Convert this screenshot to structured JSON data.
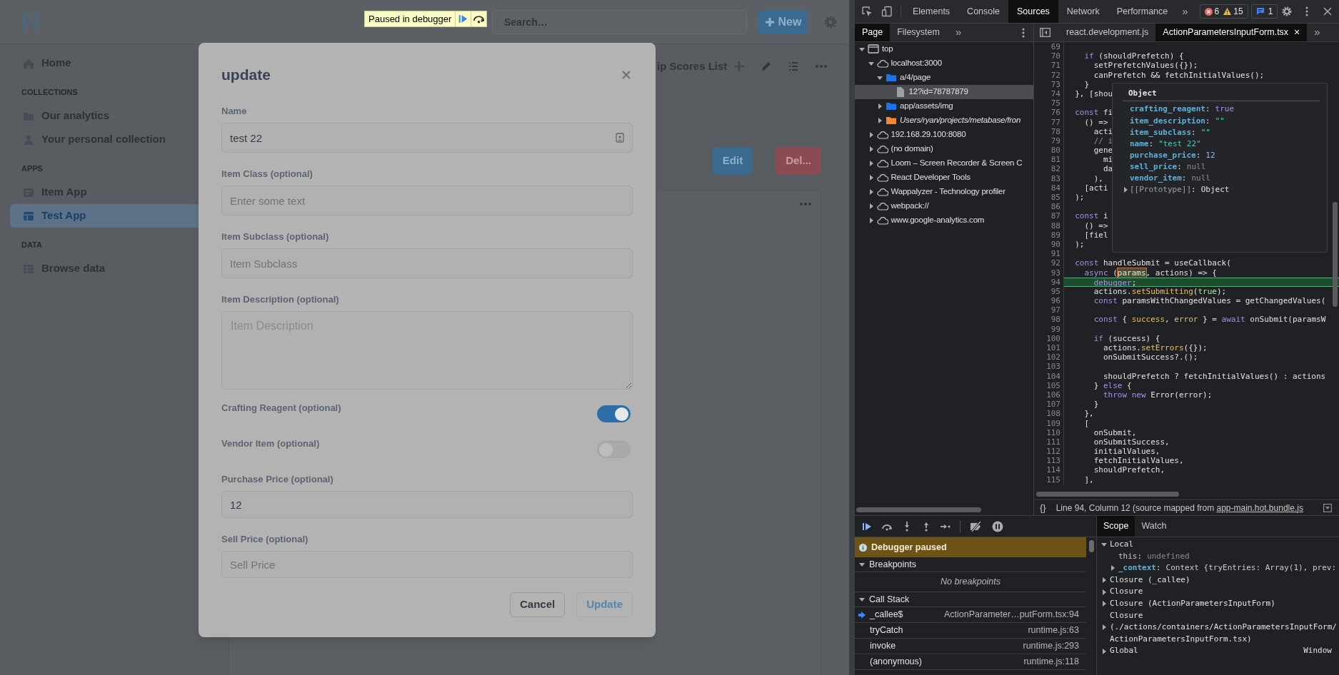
{
  "app": {
    "debugger_banner": {
      "label": "Paused in debugger"
    },
    "search": {
      "placeholder": "Search…"
    },
    "new_button": "New",
    "sidebar": [
      {
        "kind": "link",
        "label": "Home",
        "selected": false
      },
      {
        "kind": "heading",
        "label": "COLLECTIONS"
      },
      {
        "kind": "link",
        "label": "Our analytics",
        "selected": false
      },
      {
        "kind": "link",
        "label": "Your personal collection",
        "selected": false
      },
      {
        "kind": "heading",
        "label": "APPS"
      },
      {
        "kind": "link",
        "label": "Item App",
        "selected": false
      },
      {
        "kind": "link",
        "label": "Test App",
        "selected": true
      },
      {
        "kind": "heading",
        "label": "DATA"
      },
      {
        "kind": "link",
        "label": "Browse data",
        "selected": false
      }
    ],
    "page": {
      "title": "ip Scores List",
      "buttons": [
        {
          "label": "Edit",
          "kind": "primary"
        },
        {
          "label": "Del...",
          "kind": "danger"
        }
      ]
    },
    "modal": {
      "title": "update",
      "fields": [
        {
          "kind": "text",
          "label": "Name",
          "value": "test 22"
        },
        {
          "kind": "text",
          "label": "Item Class (optional)",
          "placeholder": "Enter some text"
        },
        {
          "kind": "text",
          "label": "Item Subclass (optional)",
          "placeholder": "Item Subclass"
        },
        {
          "kind": "textarea",
          "label": "Item Description (optional)",
          "placeholder": "Item Description"
        },
        {
          "kind": "toggle",
          "label": "Crafting Reagent (optional)",
          "on": true
        },
        {
          "kind": "toggle",
          "label": "Vendor Item (optional)",
          "on": false
        },
        {
          "kind": "text",
          "label": "Purchase Price (optional)",
          "value": "12"
        },
        {
          "kind": "text",
          "label": "Sell Price (optional)",
          "placeholder": "Sell Price"
        }
      ],
      "buttons": [
        {
          "label": "Cancel",
          "disabled": false
        },
        {
          "label": "Update",
          "disabled": true
        }
      ]
    }
  },
  "devtools": {
    "tabs": [
      {
        "label": "Elements",
        "selected": false
      },
      {
        "label": "Console",
        "selected": false
      },
      {
        "label": "Sources",
        "selected": true
      },
      {
        "label": "Network",
        "selected": false
      },
      {
        "label": "Performance",
        "selected": false
      }
    ],
    "more_tabs": "»",
    "counts": {
      "errors": "6",
      "warnings": "15",
      "messages": "1"
    },
    "navigator": {
      "tabs": [
        {
          "label": "Page",
          "selected": true
        },
        {
          "label": "Filesystem",
          "selected": false
        }
      ],
      "more": "»",
      "tree": [
        {
          "kind": "frame",
          "label": "top",
          "expanded": true,
          "selected": false,
          "children": [
            {
              "kind": "domain",
              "label": "localhost:3000",
              "expanded": true,
              "selected": false,
              "children": [
                {
                  "kind": "folder",
                  "label": "a/4/page",
                  "expanded": true,
                  "selected": false,
                  "children": [
                    {
                      "kind": "file",
                      "label": "12?id=78787879",
                      "selected": true
                    }
                  ]
                },
                {
                  "kind": "folder",
                  "label": "app/assets/img",
                  "expanded": false,
                  "selected": false
                },
                {
                  "kind": "override-folder",
                  "label": "Users/ryan/projects/metabase/fron",
                  "expanded": false,
                  "selected": false
                }
              ]
            },
            {
              "kind": "domain",
              "label": "192.168.29.100:8080",
              "expanded": false,
              "selected": false
            },
            {
              "kind": "domain",
              "label": "(no domain)",
              "expanded": false,
              "selected": false
            },
            {
              "kind": "domain",
              "label": "Loom – Screen Recorder & Screen C",
              "expanded": false,
              "selected": false
            },
            {
              "kind": "domain",
              "label": "React Developer Tools",
              "expanded": false,
              "selected": false
            },
            {
              "kind": "domain",
              "label": "Wappalyzer - Technology profiler",
              "expanded": false,
              "selected": false
            },
            {
              "kind": "domain",
              "label": "webpack://",
              "expanded": false,
              "selected": false
            },
            {
              "kind": "domain",
              "label": "www.google-analytics.com",
              "expanded": false,
              "selected": false
            }
          ]
        }
      ]
    },
    "editor": {
      "tabs": [
        {
          "label": "react.development.js",
          "selected": false
        },
        {
          "label": "ActionParametersInputForm.tsx",
          "selected": true
        }
      ],
      "close": "×",
      "more": "»",
      "lines": [
        {
          "n": "69",
          "paused": false
        },
        {
          "n": "70",
          "paused": false,
          "code": [
            {
              "kind": "keyword",
              "text": "    if"
            },
            {
              "kind": "plain",
              "text": " (shouldPrefetch) {"
            }
          ]
        },
        {
          "n": "71",
          "paused": false,
          "code": [
            {
              "kind": "plain",
              "text": "      setPrefetchValues({});"
            }
          ]
        },
        {
          "n": "72",
          "paused": false,
          "code": [
            {
              "kind": "plain",
              "text": "      canPrefetch && fetchInitialValues();"
            }
          ]
        },
        {
          "n": "73",
          "paused": false,
          "code": [
            {
              "kind": "plain",
              "text": "    }"
            }
          ]
        },
        {
          "n": "74",
          "paused": false,
          "code": [
            {
              "kind": "plain",
              "text": "  }, [shou"
            }
          ]
        },
        {
          "n": "75",
          "paused": false
        },
        {
          "n": "76",
          "paused": false,
          "code": [
            {
              "kind": "keyword",
              "text": "  const"
            },
            {
              "kind": "plain",
              "text": " fi"
            }
          ]
        },
        {
          "n": "77",
          "paused": false,
          "code": [
            {
              "kind": "plain",
              "text": "    () =>"
            }
          ]
        },
        {
          "n": "78",
          "paused": false,
          "code": [
            {
              "kind": "plain",
              "text": "      acti"
            }
          ]
        },
        {
          "n": "79",
          "paused": false,
          "code": [
            {
              "kind": "comment",
              "text": "      // i"
            }
          ]
        },
        {
          "n": "80",
          "paused": false,
          "code": [
            {
              "kind": "plain",
              "text": "      gene"
            }
          ]
        },
        {
          "n": "81",
          "paused": false,
          "code": [
            {
              "kind": "plain",
              "text": "        mi"
            }
          ]
        },
        {
          "n": "82",
          "paused": false,
          "code": [
            {
              "kind": "plain",
              "text": "        da"
            }
          ]
        },
        {
          "n": "83",
          "paused": false,
          "code": [
            {
              "kind": "plain",
              "text": "      ),"
            }
          ]
        },
        {
          "n": "84",
          "paused": false,
          "code": [
            {
              "kind": "plain",
              "text": "    [acti"
            }
          ]
        },
        {
          "n": "85",
          "paused": false,
          "code": [
            {
              "kind": "plain",
              "text": "  );"
            }
          ]
        },
        {
          "n": "86",
          "paused": false
        },
        {
          "n": "87",
          "paused": false,
          "code": [
            {
              "kind": "keyword",
              "text": "  const"
            },
            {
              "kind": "plain",
              "text": " i"
            }
          ]
        },
        {
          "n": "88",
          "paused": false,
          "code": [
            {
              "kind": "plain",
              "text": "    () =>"
            }
          ]
        },
        {
          "n": "89",
          "paused": false,
          "code": [
            {
              "kind": "plain",
              "text": "    [fiel"
            }
          ]
        },
        {
          "n": "90",
          "paused": false,
          "code": [
            {
              "kind": "plain",
              "text": "  );"
            }
          ]
        },
        {
          "n": "91",
          "paused": false
        },
        {
          "n": "92",
          "paused": false,
          "code": [
            {
              "kind": "keyword",
              "text": "  const"
            },
            {
              "kind": "plain",
              "text": " handleSubmit = useCallback("
            }
          ]
        },
        {
          "n": "93",
          "paused": false,
          "code": [
            {
              "kind": "keyword",
              "text": "    async"
            },
            {
              "kind": "plain",
              "text": " ("
            },
            {
              "kind": "param",
              "text": "params"
            },
            {
              "kind": "plain",
              "text": ", actions) => {"
            }
          ]
        },
        {
          "n": "94",
          "paused": true,
          "code": [
            {
              "kind": "keyword",
              "text": "      debugger"
            },
            {
              "kind": "plain",
              "text": ";"
            }
          ]
        },
        {
          "n": "95",
          "paused": false,
          "code": [
            {
              "kind": "plain",
              "text": "      actions."
            },
            {
              "kind": "function",
              "text": "setSubmitting"
            },
            {
              "kind": "plain",
              "text": "("
            },
            {
              "kind": "literal",
              "text": "true"
            },
            {
              "kind": "plain",
              "text": ");"
            }
          ]
        },
        {
          "n": "96",
          "paused": false,
          "code": [
            {
              "kind": "keyword",
              "text": "      const"
            },
            {
              "kind": "plain",
              "text": " paramsWithChangedValues = getChangedValues("
            }
          ]
        },
        {
          "n": "97",
          "paused": false
        },
        {
          "n": "98",
          "paused": false,
          "code": [
            {
              "kind": "keyword",
              "text": "      const"
            },
            {
              "kind": "plain",
              "text": " { "
            },
            {
              "kind": "function",
              "text": "success"
            },
            {
              "kind": "plain",
              "text": ", "
            },
            {
              "kind": "function",
              "text": "error"
            },
            {
              "kind": "plain",
              "text": " } = "
            },
            {
              "kind": "keyword",
              "text": "await"
            },
            {
              "kind": "plain",
              "text": " onSubmit(paramsW"
            }
          ]
        },
        {
          "n": "99",
          "paused": false
        },
        {
          "n": "100",
          "paused": false,
          "code": [
            {
              "kind": "keyword",
              "text": "      if"
            },
            {
              "kind": "plain",
              "text": " (success) {"
            }
          ]
        },
        {
          "n": "101",
          "paused": false,
          "code": [
            {
              "kind": "plain",
              "text": "        actions."
            },
            {
              "kind": "function",
              "text": "setErrors"
            },
            {
              "kind": "plain",
              "text": "({});"
            }
          ]
        },
        {
          "n": "102",
          "paused": false,
          "code": [
            {
              "kind": "plain",
              "text": "        onSubmitSuccess?.();"
            }
          ]
        },
        {
          "n": "103",
          "paused": false
        },
        {
          "n": "104",
          "paused": false,
          "code": [
            {
              "kind": "plain",
              "text": "        shouldPrefetch ? fetchInitialValues() : actions"
            }
          ]
        },
        {
          "n": "105",
          "paused": false,
          "code": [
            {
              "kind": "plain",
              "text": "      }"
            },
            {
              "kind": "keyword",
              "text": " else"
            },
            {
              "kind": "plain",
              "text": " {"
            }
          ]
        },
        {
          "n": "106",
          "paused": false,
          "code": [
            {
              "kind": "keyword",
              "text": "        throw new"
            },
            {
              "kind": "plain",
              "text": " Error(error);"
            }
          ]
        },
        {
          "n": "107",
          "paused": false,
          "code": [
            {
              "kind": "plain",
              "text": "      }"
            }
          ]
        },
        {
          "n": "108",
          "paused": false,
          "code": [
            {
              "kind": "plain",
              "text": "    },"
            }
          ]
        },
        {
          "n": "109",
          "paused": false,
          "code": [
            {
              "kind": "plain",
              "text": "    ["
            }
          ]
        },
        {
          "n": "110",
          "paused": false,
          "code": [
            {
              "kind": "plain",
              "text": "      onSubmit,"
            }
          ]
        },
        {
          "n": "111",
          "paused": false,
          "code": [
            {
              "kind": "plain",
              "text": "      onSubmitSuccess,"
            }
          ]
        },
        {
          "n": "112",
          "paused": false,
          "code": [
            {
              "kind": "plain",
              "text": "      initialValues,"
            }
          ]
        },
        {
          "n": "113",
          "paused": false,
          "code": [
            {
              "kind": "plain",
              "text": "      fetchInitialValues,"
            }
          ]
        },
        {
          "n": "114",
          "paused": false,
          "code": [
            {
              "kind": "plain",
              "text": "      shouldPrefetch,"
            }
          ]
        },
        {
          "n": "115",
          "paused": false,
          "code": [
            {
              "kind": "plain",
              "text": "    ],"
            }
          ]
        }
      ],
      "popover": {
        "title": "Object",
        "separator": ":",
        "entries": [
          {
            "key": "crafting_reagent",
            "value": "true",
            "kind": "boolean"
          },
          {
            "key": "item_description",
            "value": "\"\"",
            "kind": "string"
          },
          {
            "key": "item_subclass",
            "value": "\"\"",
            "kind": "string"
          },
          {
            "key": "name",
            "value": "\"test 22\"",
            "kind": "string"
          },
          {
            "key": "purchase_price",
            "value": "12",
            "kind": "number"
          },
          {
            "key": "sell_price",
            "value": "null",
            "kind": "null"
          },
          {
            "key": "vendor_item",
            "value": "null",
            "kind": "null"
          },
          {
            "key": "[[Prototype]]",
            "value": "Object",
            "kind": "prototype",
            "expanded": false
          }
        ]
      },
      "format_button": "{}",
      "status": {
        "position": "Line 94, Column 12",
        "source_prefix": "(source mapped from",
        "source_link": "app-main.hot.bundle.js"
      }
    },
    "debugger": {
      "banner": "Debugger paused",
      "breakpoints": {
        "title": "Breakpoints",
        "expanded": true,
        "empty": "No breakpoints"
      },
      "call_stack": {
        "title": "Call Stack",
        "expanded": true,
        "frames": [
          {
            "name": "_callee$",
            "location": "ActionParameter…putForm.tsx:94",
            "selected": true
          },
          {
            "name": "tryCatch",
            "location": "runtime.js:63",
            "selected": false
          },
          {
            "name": "invoke",
            "location": "runtime.js:293",
            "selected": false
          },
          {
            "name": "(anonymous)",
            "location": "runtime.js:118",
            "selected": false
          }
        ]
      }
    },
    "scope": {
      "tabs": [
        {
          "label": "Scope",
          "selected": true
        },
        {
          "label": "Watch",
          "selected": false
        }
      ],
      "separator": ":",
      "tree": [
        {
          "label": "Local",
          "expanded": true,
          "children": [
            {
              "key": "this",
              "value": "undefined",
              "kind": "primitive"
            },
            {
              "key": "_context",
              "value": "Context {tryEntries: Array(1), prev:",
              "kind": "object",
              "expanded": false
            }
          ]
        },
        {
          "label": "Closure (_callee)",
          "expanded": false
        },
        {
          "label": "Closure",
          "expanded": false
        },
        {
          "label": "Closure (ActionParametersInputForm)",
          "expanded": false
        },
        {
          "label": "Closure",
          "path": "(./actions/containers/ActionParametersInputForm/ActionParametersInputForm.tsx)",
          "expanded": false
        },
        {
          "label": "Global",
          "value": "Window",
          "expanded": false
        }
      ]
    }
  }
}
